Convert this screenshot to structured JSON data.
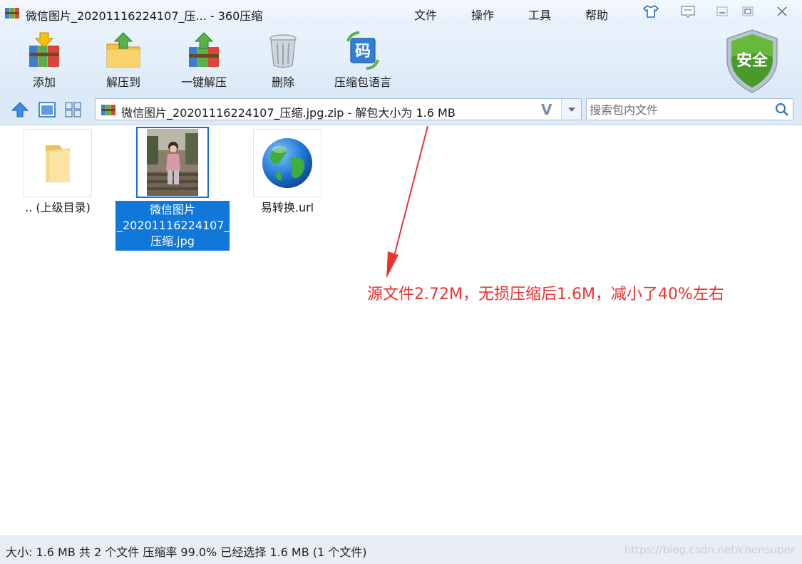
{
  "window": {
    "title": "微信图片_20201116224107_压... - 360压缩",
    "menus": [
      "文件",
      "操作",
      "工具",
      "帮助"
    ]
  },
  "toolbar": {
    "buttons": [
      {
        "label": "添加",
        "icon": "add-archive-icon"
      },
      {
        "label": "解压到",
        "icon": "extract-to-icon"
      },
      {
        "label": "一键解压",
        "icon": "one-click-extract-icon"
      },
      {
        "label": "删除",
        "icon": "trash-icon"
      },
      {
        "label": "压缩包语言",
        "icon": "language-code-icon"
      }
    ],
    "badge": "安全"
  },
  "address": {
    "path": "微信图片_20201116224107_压缩.jpg.zip - 解包大小为 1.6 MB",
    "v_mark": "V"
  },
  "search": {
    "placeholder": "搜索包内文件"
  },
  "files": [
    {
      "label": ".. (上级目录)",
      "icon": "folder-icon",
      "selected": false
    },
    {
      "label_lines": [
        "微信图片",
        "_20201116224107_",
        "压缩.jpg"
      ],
      "icon": "photo-thumbnail",
      "selected": true
    },
    {
      "label": "易转换.url",
      "icon": "globe-icon",
      "selected": false
    }
  ],
  "annotation": {
    "text": "源文件2.72M，无损压缩后1.6M，减小了40%左右",
    "color": "#e8332f"
  },
  "status": {
    "text": "大小: 1.6 MB 共 2 个文件 压缩率 99.0% 已经选择 1.6 MB (1 个文件)",
    "watermark": "https://blog.csdn.net/chensuper"
  },
  "colors": {
    "selection": "#1177d8",
    "toolbar": "#dbe9f7",
    "shield": "#4a9a2a"
  }
}
